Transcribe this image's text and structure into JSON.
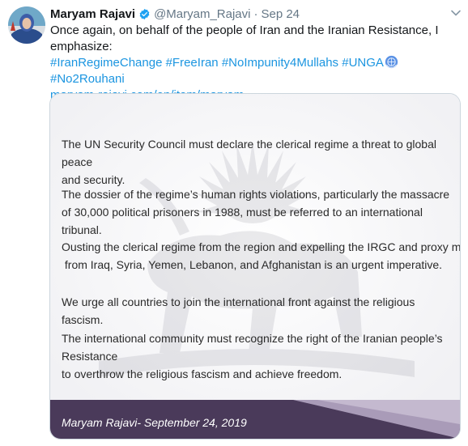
{
  "author": {
    "name": "Maryam Rajavi",
    "handle": "@Maryam_Rajavi",
    "separator": "·",
    "date": "Sep 24"
  },
  "tweet": {
    "text_line1": "Once again, on behalf of the people of Iran and the Iranian Resistance, I",
    "text_line2": "emphasize:",
    "hashtags": [
      "#IranRegimeChange",
      "#FreeIran",
      "#NoImpunity4Mullahs",
      "#UNGA",
      "#No2Rouhani"
    ],
    "link": "maryam-rajavi.com/en/item/maryam..."
  },
  "card": {
    "paragraphs": [
      [
        "The UN Security Council must declare the clerical regime a threat to global peace",
        "and security."
      ],
      [
        "The dossier of the regime’s human rights violations, particularly the massacre",
        "of 30,000 political prisoners in 1988, must be referred to an international tribunal."
      ],
      [
        "Ousting the clerical regime from the region and expelling the IRGC and proxy militias",
        " from Iraq, Syria, Yemen, Lebanon, and Afghanistan is an urgent imperative."
      ],
      [
        "We urge all countries to join the international front against the religious fascism."
      ],
      [
        "The international community must recognize the right of the Iranian people’s Resistance",
        "to overthrow the religious fascism and achieve freedom."
      ]
    ],
    "signature": "Maryam Rajavi- September 24, 2019"
  },
  "icons": {
    "verified": "verified-badge-icon",
    "caret": "chevron-down-icon",
    "un": "un-flag-emoji-icon",
    "watermark": "lion-and-sun-emblem"
  },
  "colors": {
    "link": "#1b95e0",
    "banner": "#4a3a5a",
    "banner_accent": "#a99bb8"
  }
}
